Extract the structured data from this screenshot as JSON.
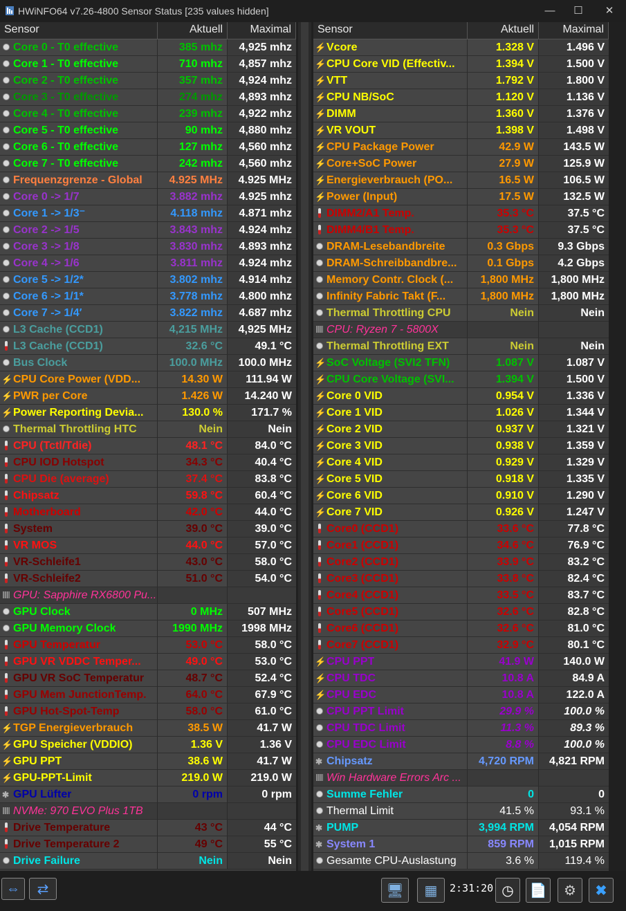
{
  "window": {
    "title": "HWiNFO64 v7.26-4800 Sensor Status [235 values hidden]"
  },
  "columns": {
    "sensor": "Sensor",
    "current": "Aktuell",
    "max": "Maximal"
  },
  "left": [
    {
      "icon": "clock",
      "label": "Core 0 - T0 effective",
      "cur": "385 mhz",
      "max": "4,925 mhz",
      "lc": "#00c000",
      "vc": "#00c000"
    },
    {
      "icon": "clock",
      "label": "Core 1 - T0 effective",
      "cur": "710 mhz",
      "max": "4,857 mhz",
      "lc": "#00ff00",
      "vc": "#00ff00"
    },
    {
      "icon": "clock",
      "label": "Core 2 - T0 effective",
      "cur": "357 mhz",
      "max": "4,924 mhz",
      "lc": "#00c000",
      "vc": "#00c000"
    },
    {
      "icon": "clock",
      "label": "Core 3 - T0 effective",
      "cur": "274 mhz",
      "max": "4,893 mhz",
      "lc": "#009900",
      "vc": "#009900"
    },
    {
      "icon": "clock",
      "label": "Core 4 - T0 effective",
      "cur": "239 mhz",
      "max": "4,922 mhz",
      "lc": "#00c000",
      "vc": "#00c000"
    },
    {
      "icon": "clock",
      "label": "Core 5 - T0 effective",
      "cur": "90 mhz",
      "max": "4,880 mhz",
      "lc": "#00ff00",
      "vc": "#00ff00"
    },
    {
      "icon": "clock",
      "label": "Core 6 - T0 effective",
      "cur": "127 mhz",
      "max": "4,560 mhz",
      "lc": "#00ff00",
      "vc": "#00ff00"
    },
    {
      "icon": "clock",
      "label": "Core 7 - T0 effective",
      "cur": "242 mhz",
      "max": "4,560 mhz",
      "lc": "#00ff00",
      "vc": "#00ff00"
    },
    {
      "icon": "clock",
      "label": "Frequenzgrenze - Global",
      "cur": "4.925 MHz",
      "max": "4.925 MHz",
      "lc": "#ff8040",
      "vc": "#ff8040"
    },
    {
      "icon": "clock",
      "label": "Core 0  -> 1/7",
      "cur": "3.882 mhz",
      "max": "4.925 mhz",
      "lc": "#9933cc",
      "vc": "#9933cc"
    },
    {
      "icon": "clock",
      "label": "Core 1  -> 1/3⁻",
      "cur": "4.118 mhz",
      "max": "4.871 mhz",
      "lc": "#3399ff",
      "vc": "#3399ff"
    },
    {
      "icon": "clock",
      "label": "Core 2  -> 1/5",
      "cur": "3.843 mhz",
      "max": "4.924 mhz",
      "lc": "#9933cc",
      "vc": "#9933cc"
    },
    {
      "icon": "clock",
      "label": "Core 3  -> 1/8",
      "cur": "3.830 mhz",
      "max": "4.893 mhz",
      "lc": "#9933cc",
      "vc": "#9933cc"
    },
    {
      "icon": "clock",
      "label": "Core 4  -> 1/6",
      "cur": "3.811 mhz",
      "max": "4.924 mhz",
      "lc": "#9933cc",
      "vc": "#9933cc"
    },
    {
      "icon": "clock",
      "label": "Core 5  -> 1/2*",
      "cur": "3.802 mhz",
      "max": "4.914 mhz",
      "lc": "#3399ff",
      "vc": "#3399ff"
    },
    {
      "icon": "clock",
      "label": "Core 6  -> 1/1*",
      "cur": "3.778 mhz",
      "max": "4.800 mhz",
      "lc": "#3399ff",
      "vc": "#3399ff"
    },
    {
      "icon": "clock",
      "label": "Core 7  -> 1/4′",
      "cur": "3.822 mhz",
      "max": "4.687 mhz",
      "lc": "#3399ff",
      "vc": "#3399ff"
    },
    {
      "icon": "clock",
      "label": "L3 Cache (CCD1)",
      "cur": "4,215 MHz",
      "max": "4,925 MHz",
      "lc": "#4a9e9e",
      "vc": "#4a9e9e"
    },
    {
      "icon": "therm",
      "label": "L3 Cache (CCD1)",
      "cur": "32.6 °C",
      "max": "49.1 °C",
      "lc": "#4a9e9e",
      "vc": "#4a9e9e"
    },
    {
      "icon": "clock",
      "label": "Bus Clock",
      "cur": "100.0 MHz",
      "max": "100.0 MHz",
      "lc": "#4a9e9e",
      "vc": "#4a9e9e"
    },
    {
      "icon": "bolt",
      "label": "CPU Core Power (VDD...",
      "cur": "14.30 W",
      "max": "111.94 W",
      "lc": "#ff9900",
      "vc": "#ff9900"
    },
    {
      "icon": "bolt",
      "label": "PWR per Core",
      "cur": "1.426 W",
      "max": "14.240 W",
      "lc": "#ff9900",
      "vc": "#ff9900"
    },
    {
      "icon": "bolt",
      "label": "Power Reporting Devia...",
      "cur": "130.0 %",
      "max": "171.7 %",
      "lc": "#ffff00",
      "vc": "#ffff00"
    },
    {
      "icon": "clock",
      "label": "Thermal Throttling HTC",
      "cur": "Nein",
      "max": "Nein",
      "lc": "#cccc33",
      "vc": "#cccc33"
    },
    {
      "icon": "therm",
      "label": "CPU (Tctl/Tdie)",
      "cur": "48.1 °C",
      "max": "84.0 °C",
      "lc": "#ff2222",
      "vc": "#ff2222"
    },
    {
      "icon": "therm",
      "label": "CPU IOD Hotspot",
      "cur": "34.3 °C",
      "max": "40.4 °C",
      "lc": "#880000",
      "vc": "#880000"
    },
    {
      "icon": "therm",
      "label": "CPU Die (average)",
      "cur": "37.4 °C",
      "max": "83.8 °C",
      "lc": "#dd1111",
      "vc": "#dd1111"
    },
    {
      "icon": "therm",
      "label": "Chipsatz",
      "cur": "59.8 °C",
      "max": "60.4 °C",
      "lc": "#ff1111",
      "vc": "#ff1111"
    },
    {
      "icon": "therm",
      "label": "Motherboard",
      "cur": "42.0 °C",
      "max": "44.0 °C",
      "lc": "#cc0000",
      "vc": "#cc0000"
    },
    {
      "icon": "therm",
      "label": "System",
      "cur": "39.0 °C",
      "max": "39.0 °C",
      "lc": "#660000",
      "vc": "#660000"
    },
    {
      "icon": "therm",
      "label": "VR MOS",
      "cur": "44.0 °C",
      "max": "57.0 °C",
      "lc": "#ff1111",
      "vc": "#ff1111"
    },
    {
      "icon": "therm",
      "label": "VR-Schleife1",
      "cur": "43.0 °C",
      "max": "58.0 °C",
      "lc": "#660000",
      "vc": "#660000"
    },
    {
      "icon": "therm",
      "label": "VR-Schleife2",
      "cur": "51.0 °C",
      "max": "54.0 °C",
      "lc": "#660000",
      "vc": "#660000"
    },
    {
      "icon": "chip",
      "label": "GPU: Sapphire RX6800 Pu...",
      "cur": "",
      "max": "",
      "lc": "#ff3399",
      "vc": "#ff3399",
      "group": true
    },
    {
      "icon": "clock",
      "label": "GPU Clock",
      "cur": "0 MHz",
      "max": "507 MHz",
      "lc": "#00ff00",
      "vc": "#00ff00"
    },
    {
      "icon": "clock",
      "label": "GPU Memory Clock",
      "cur": "1990 MHz",
      "max": "1998 MHz",
      "lc": "#00ff00",
      "vc": "#00ff00"
    },
    {
      "icon": "therm",
      "label": "GPU Temperatur",
      "cur": "53.0 °C",
      "max": "58.0 °C",
      "lc": "#cc0000",
      "vc": "#cc0000"
    },
    {
      "icon": "therm",
      "label": "GPU VR VDDC Temper...",
      "cur": "49.0 °C",
      "max": "53.0 °C",
      "lc": "#ff1111",
      "vc": "#ff1111"
    },
    {
      "icon": "therm",
      "label": "GPU VR SoC Temperatur",
      "cur": "48.7 °C",
      "max": "52.4 °C",
      "lc": "#660000",
      "vc": "#660000"
    },
    {
      "icon": "therm",
      "label": "GPU Mem JunctionTemp.",
      "cur": "64.0 °C",
      "max": "67.9 °C",
      "lc": "#990000",
      "vc": "#990000"
    },
    {
      "icon": "therm",
      "label": "GPU Hot-Spot-Temp",
      "cur": "58.0 °C",
      "max": "61.0 °C",
      "lc": "#990000",
      "vc": "#990000"
    },
    {
      "icon": "bolt",
      "label": "TGP Energieverbrauch",
      "cur": "38.5 W",
      "max": "41.7 W",
      "lc": "#ff9900",
      "vc": "#ff9900"
    },
    {
      "icon": "bolt",
      "label": "GPU Speicher (VDDIO)",
      "cur": "1.36 V",
      "max": "1.36 V",
      "lc": "#ffff00",
      "vc": "#ffff00"
    },
    {
      "icon": "bolt",
      "label": "GPU PPT",
      "cur": "38.6 W",
      "max": "41.7 W",
      "lc": "#ffff00",
      "vc": "#ffff00"
    },
    {
      "icon": "bolt",
      "label": "GPU-PPT-Limit",
      "cur": "219.0 W",
      "max": "219.0 W",
      "lc": "#ffff00",
      "vc": "#ffff00"
    },
    {
      "icon": "fan",
      "label": "GPU Lüfter",
      "cur": "0 rpm",
      "max": "0 rpm",
      "lc": "#0000aa",
      "vc": "#0000aa"
    },
    {
      "icon": "chip",
      "label": "NVMe: 970 EVO Plus 1TB",
      "cur": "",
      "max": "",
      "lc": "#ff3399",
      "vc": "#ff3399",
      "group": true
    },
    {
      "icon": "therm",
      "label": "Drive Temperature",
      "cur": "43 °C",
      "max": "44 °C",
      "lc": "#660000",
      "vc": "#660000"
    },
    {
      "icon": "therm",
      "label": "Drive Temperature 2",
      "cur": "49 °C",
      "max": "55 °C",
      "lc": "#660000",
      "vc": "#660000"
    },
    {
      "icon": "clock",
      "label": "Drive Failure",
      "cur": "Nein",
      "max": "Nein",
      "lc": "#00e5e5",
      "vc": "#00e5e5"
    }
  ],
  "right": [
    {
      "icon": "bolt",
      "label": "Vcore",
      "cur": "1.328 V",
      "max": "1.496 V",
      "lc": "#ffff00",
      "vc": "#ffff00"
    },
    {
      "icon": "bolt",
      "label": "CPU Core VID (Effectiv...",
      "cur": "1.394 V",
      "max": "1.500 V",
      "lc": "#ffff00",
      "vc": "#ffff00"
    },
    {
      "icon": "bolt",
      "label": "VTT",
      "cur": "1.792 V",
      "max": "1.800 V",
      "lc": "#ffff00",
      "vc": "#ffff00"
    },
    {
      "icon": "bolt",
      "label": "CPU NB/SoC",
      "cur": "1.120 V",
      "max": "1.136 V",
      "lc": "#ffff00",
      "vc": "#ffff00"
    },
    {
      "icon": "bolt",
      "label": "DIMM",
      "cur": "1.360 V",
      "max": "1.376 V",
      "lc": "#ffff00",
      "vc": "#ffff00"
    },
    {
      "icon": "bolt",
      "label": "VR VOUT",
      "cur": "1.398 V",
      "max": "1.498 V",
      "lc": "#ffff00",
      "vc": "#ffff00"
    },
    {
      "icon": "bolt",
      "label": "CPU Package Power",
      "cur": "42.9 W",
      "max": "143.5 W",
      "lc": "#ff9900",
      "vc": "#ff9900"
    },
    {
      "icon": "bolt",
      "label": "Core+SoC Power",
      "cur": "27.9 W",
      "max": "125.9 W",
      "lc": "#ff9900",
      "vc": "#ff9900"
    },
    {
      "icon": "bolt",
      "label": "Energieverbrauch (PO...",
      "cur": "16.5 W",
      "max": "106.5 W",
      "lc": "#ff9900",
      "vc": "#ff9900"
    },
    {
      "icon": "bolt",
      "label": "Power (Input)",
      "cur": "17.5 W",
      "max": "132.5 W",
      "lc": "#ff9900",
      "vc": "#ff9900"
    },
    {
      "icon": "therm",
      "label": "DIMM2/A1 Temp.",
      "cur": "35.3 °C",
      "max": "37.5 °C",
      "lc": "#cc0000",
      "vc": "#cc0000"
    },
    {
      "icon": "therm",
      "label": "DIMM4/B1 Temp.",
      "cur": "35.3 °C",
      "max": "37.5 °C",
      "lc": "#cc0000",
      "vc": "#cc0000"
    },
    {
      "icon": "clock",
      "label": "DRAM-Lesebandbreite",
      "cur": "0.3 Gbps",
      "max": "9.3 Gbps",
      "lc": "#ff9900",
      "vc": "#ff9900"
    },
    {
      "icon": "clock",
      "label": "DRAM-Schreibbandbre...",
      "cur": "0.1 Gbps",
      "max": "4.2 Gbps",
      "lc": "#ff9900",
      "vc": "#ff9900"
    },
    {
      "icon": "clock",
      "label": "Memory Contr. Clock (...",
      "cur": "1,800 MHz",
      "max": "1,800 MHz",
      "lc": "#ff9900",
      "vc": "#ff9900"
    },
    {
      "icon": "clock",
      "label": "Infinity Fabric Takt (F...",
      "cur": "1,800 MHz",
      "max": "1,800 MHz",
      "lc": "#ff9900",
      "vc": "#ff9900"
    },
    {
      "icon": "clock",
      "label": "Thermal Throttling CPU",
      "cur": "Nein",
      "max": "Nein",
      "lc": "#cccc33",
      "vc": "#cccc33"
    },
    {
      "icon": "chip",
      "label": "CPU: Ryzen 7 - 5800X",
      "cur": "",
      "max": "",
      "lc": "#ff3399",
      "vc": "#ff3399",
      "group": true
    },
    {
      "icon": "clock",
      "label": "Thermal Throttling  EXT",
      "cur": "Nein",
      "max": "Nein",
      "lc": "#cccc33",
      "vc": "#cccc33"
    },
    {
      "icon": "bolt",
      "label": "SoC Voltage (SVI2 TFN)",
      "cur": "1.087 V",
      "max": "1.087 V",
      "lc": "#00c000",
      "vc": "#00c000"
    },
    {
      "icon": "bolt",
      "label": "CPU Core Voltage (SVI...",
      "cur": "1.394 V",
      "max": "1.500 V",
      "lc": "#00c000",
      "vc": "#00c000"
    },
    {
      "icon": "bolt",
      "label": "Core 0 VID",
      "cur": "0.954 V",
      "max": "1.336 V",
      "lc": "#ffff00",
      "vc": "#ffff00"
    },
    {
      "icon": "bolt",
      "label": "Core 1 VID",
      "cur": "1.026 V",
      "max": "1.344 V",
      "lc": "#ffff00",
      "vc": "#ffff00"
    },
    {
      "icon": "bolt",
      "label": "Core 2 VID",
      "cur": "0.937 V",
      "max": "1.321 V",
      "lc": "#ffff00",
      "vc": "#ffff00"
    },
    {
      "icon": "bolt",
      "label": "Core 3 VID",
      "cur": "0.938 V",
      "max": "1.359 V",
      "lc": "#ffff00",
      "vc": "#ffff00"
    },
    {
      "icon": "bolt",
      "label": "Core 4 VID",
      "cur": "0.929 V",
      "max": "1.329 V",
      "lc": "#ffff00",
      "vc": "#ffff00"
    },
    {
      "icon": "bolt",
      "label": "Core 5 VID",
      "cur": "0.918 V",
      "max": "1.335 V",
      "lc": "#ffff00",
      "vc": "#ffff00"
    },
    {
      "icon": "bolt",
      "label": "Core 6 VID",
      "cur": "0.910 V",
      "max": "1.290 V",
      "lc": "#ffff00",
      "vc": "#ffff00"
    },
    {
      "icon": "bolt",
      "label": "Core 7 VID",
      "cur": "0.926 V",
      "max": "1.247 V",
      "lc": "#ffff00",
      "vc": "#ffff00"
    },
    {
      "icon": "therm",
      "label": "Core0 (CCD1)",
      "cur": "33.6 °C",
      "max": "77.8 °C",
      "lc": "#cc0000",
      "vc": "#cc0000"
    },
    {
      "icon": "therm",
      "label": "Core1 (CCD1)",
      "cur": "34.6 °C",
      "max": "76.9 °C",
      "lc": "#cc0000",
      "vc": "#cc0000"
    },
    {
      "icon": "therm",
      "label": "Core2 (CCD1)",
      "cur": "33.9 °C",
      "max": "83.2 °C",
      "lc": "#cc0000",
      "vc": "#cc0000"
    },
    {
      "icon": "therm",
      "label": "Core3 (CCD1)",
      "cur": "33.8 °C",
      "max": "82.4 °C",
      "lc": "#cc0000",
      "vc": "#cc0000"
    },
    {
      "icon": "therm",
      "label": "Core4 (CCD1)",
      "cur": "33.5 °C",
      "max": "83.7 °C",
      "lc": "#cc0000",
      "vc": "#cc0000"
    },
    {
      "icon": "therm",
      "label": "Core5 (CCD1)",
      "cur": "32.6 °C",
      "max": "82.8 °C",
      "lc": "#cc0000",
      "vc": "#cc0000"
    },
    {
      "icon": "therm",
      "label": "Core6 (CCD1)",
      "cur": "32.6 °C",
      "max": "81.0 °C",
      "lc": "#cc0000",
      "vc": "#cc0000"
    },
    {
      "icon": "therm",
      "label": "Core7 (CCD1)",
      "cur": "32.9 °C",
      "max": "80.1 °C",
      "lc": "#cc0000",
      "vc": "#cc0000"
    },
    {
      "icon": "bolt",
      "label": "CPU PPT",
      "cur": "41.9 W",
      "max": "140.0 W",
      "lc": "#9900cc",
      "vc": "#9900cc"
    },
    {
      "icon": "bolt",
      "label": "CPU TDC",
      "cur": "10.8 A",
      "max": "84.9 A",
      "lc": "#9900cc",
      "vc": "#9900cc"
    },
    {
      "icon": "bolt",
      "label": "CPU EDC",
      "cur": "10.8 A",
      "max": "122.0 A",
      "lc": "#9900cc",
      "vc": "#9900cc"
    },
    {
      "icon": "clock",
      "label": "CPU PPT Limit",
      "cur": "29.9 %",
      "max": "100.0 %",
      "lc": "#9900cc",
      "vc": "#9900cc",
      "italic": true
    },
    {
      "icon": "clock",
      "label": "CPU TDC Limit",
      "cur": "11.3 %",
      "max": "89.3 %",
      "lc": "#9900cc",
      "vc": "#9900cc",
      "italic": true
    },
    {
      "icon": "clock",
      "label": "CPU EDC Limit",
      "cur": "8.8 %",
      "max": "100.0 %",
      "lc": "#9900cc",
      "vc": "#9900cc",
      "italic": true
    },
    {
      "icon": "fan",
      "label": "Chipsatz",
      "cur": "4,720 RPM",
      "max": "4,821 RPM",
      "lc": "#6699ff",
      "vc": "#6699ff"
    },
    {
      "icon": "chip",
      "label": "Win Hardware Errors Arc ...",
      "cur": "",
      "max": "",
      "lc": "#ff3399",
      "vc": "#ff3399",
      "group": true
    },
    {
      "icon": "clock",
      "label": "Summe Fehler",
      "cur": "0",
      "max": "0",
      "lc": "#00e5e5",
      "vc": "#00e5e5"
    },
    {
      "icon": "clock",
      "label": "Thermal Limit",
      "cur": "41.5 %",
      "max": "93.1 %",
      "lc": "#ffffff",
      "vc": "#ffffff",
      "plain": true
    },
    {
      "icon": "fan",
      "label": "PUMP",
      "cur": "3,994 RPM",
      "max": "4,054 RPM",
      "lc": "#00e5e5",
      "vc": "#00e5e5"
    },
    {
      "icon": "fan",
      "label": "System 1",
      "cur": "859 RPM",
      "max": "1,015 RPM",
      "lc": "#8888ff",
      "vc": "#8888ff"
    },
    {
      "icon": "clock",
      "label": "Gesamte CPU-Auslastung",
      "cur": "3.6 %",
      "max": "119.4 %",
      "lc": "#ffffff",
      "vc": "#ffffff",
      "plain": true
    }
  ],
  "toolbar": {
    "clock": "2:31:20"
  },
  "icons": [
    "app-icon",
    "minimize-icon",
    "maximize-icon",
    "close-icon",
    "expand-arrows-icon",
    "collapse-arrows-icon",
    "network-pc-icon",
    "network-icon",
    "clock-icon",
    "report-icon",
    "settings-gear-icon",
    "exit-x-icon"
  ]
}
